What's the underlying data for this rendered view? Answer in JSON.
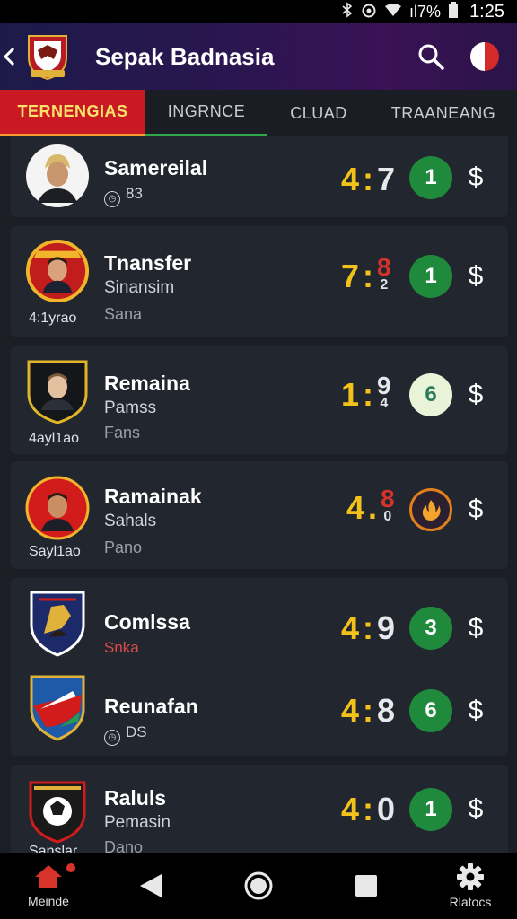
{
  "status_bar": {
    "bluetooth_icon": "bluetooth-icon",
    "alarm_icon": "alarm-icon",
    "wifi_icon": "wifi-icon",
    "signal_text": "ıl7%",
    "battery_icon": "battery-icon",
    "time": "1:25"
  },
  "app_bar": {
    "title": "Sepak Badnasia",
    "back_icon": "chevron-left-icon",
    "search_icon": "search-icon",
    "profile_icon": "profile-icon"
  },
  "tabs": [
    {
      "label": "TERNENGIAS",
      "active": true
    },
    {
      "label": "INGRNCE",
      "active": false
    },
    {
      "label": "CLUAD",
      "active": false
    },
    {
      "label": "TRAANEANG",
      "active": false
    }
  ],
  "items": [
    {
      "name": "Samereilal",
      "sub1": "83",
      "sub2": "",
      "caption": "",
      "home": "4",
      "away": "7",
      "away_color": "white",
      "badge": "1",
      "badge_style": "green",
      "dollar": "$"
    },
    {
      "name": "Tnansfer",
      "sub1": "Sinansim",
      "sub2": "Sana",
      "caption": "4:1yrao",
      "home": "7",
      "away": "8",
      "away_sub": "2",
      "away_color": "red",
      "badge": "1",
      "badge_style": "green",
      "dollar": "$"
    },
    {
      "name": "Remaina",
      "sub1": "Pamss",
      "sub2": "Fans",
      "caption": "4ayl1ao",
      "home": "1",
      "away": "9",
      "away_sub": "4",
      "away_color": "white",
      "badge": "6",
      "badge_style": "pale",
      "dollar": "$"
    },
    {
      "name": "Ramainak",
      "sub1": "Sahals",
      "sub2": "Pano",
      "caption": "Sayl1ao",
      "home": "4",
      "away": "8",
      "away_sub": "0",
      "away_color": "red",
      "badge": "",
      "badge_style": "orange",
      "dollar": "$"
    },
    {
      "name": "Comlssa",
      "sub1": "Snka",
      "sub2": "",
      "caption": "",
      "home": "4",
      "away": "9",
      "away_color": "white",
      "badge": "3",
      "badge_style": "green",
      "dollar": "$"
    },
    {
      "name": "Reunafan",
      "sub1": "DS",
      "sub2": "",
      "caption": "",
      "home": "4",
      "away": "8",
      "away_color": "white",
      "badge": "6",
      "badge_style": "green",
      "dollar": "$"
    },
    {
      "name": "Raluls",
      "sub1": "Pemasin",
      "sub2": "Dano",
      "caption": "Sanslar",
      "home": "4",
      "away": "0",
      "away_color": "white",
      "badge": "1",
      "badge_style": "green",
      "dollar": "$"
    }
  ],
  "bottom_nav": {
    "home_label": "Meinde",
    "home_icon": "home-icon",
    "back_icon": "back-triangle-icon",
    "circle_icon": "home-circle-icon",
    "square_icon": "recents-square-icon",
    "settings_label": "Rlatocs",
    "settings_icon": "gear-icon"
  },
  "colors": {
    "accent_red": "#c91a24",
    "score_yellow": "#f2c21b",
    "badge_green": "#1f8a3c",
    "tab_underline_green": "#2eaa4a"
  }
}
